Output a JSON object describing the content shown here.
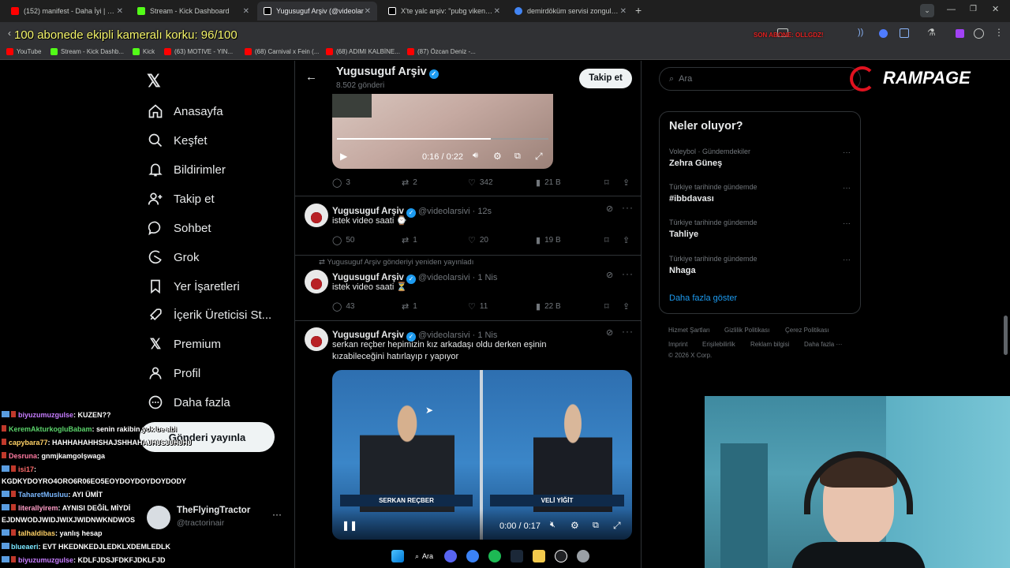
{
  "browser": {
    "tabs": [
      {
        "label": "(152) manifest - Daha İyi | Offic",
        "color": "#ff0000",
        "active": false
      },
      {
        "label": "Stream - Kick Dashboard",
        "color": "#53fc18",
        "active": false
      },
      {
        "label": "Yugusuguf Arşiv (@videolar",
        "color": "#ffffff",
        "active": true
      },
      {
        "label": "X'te yalc arşiv: \"pubg vikendi h",
        "color": "#ffffff",
        "active": false
      },
      {
        "label": "demirdöküm servisi zonguldak",
        "color": "#4285f4",
        "active": false
      }
    ],
    "new_tab": "+",
    "overlay_title": "100 abonede ekipli kameralı korku: 96/100",
    "overlay_sub": "SON ABONE: OLLGDZ!",
    "bookmarks": [
      {
        "label": "YouTube",
        "color": "#ff0000"
      },
      {
        "label": "Stream - Kick Dashb...",
        "color": "#53fc18"
      },
      {
        "label": "Kick",
        "color": "#53fc18"
      },
      {
        "label": "(63) MOTIVE - YIN...",
        "color": "#ff0000"
      },
      {
        "label": "(68) Carnival x Fein (...",
        "color": "#ff0000"
      },
      {
        "label": "(68) ADIMI KALBİNE...",
        "color": "#ff0000"
      },
      {
        "label": "(87) Özcan Deniz -...",
        "color": "#ff0000"
      }
    ]
  },
  "sidebar": {
    "items": [
      {
        "label": "Anasayfa",
        "icon": "home-icon"
      },
      {
        "label": "Keşfet",
        "icon": "search-icon"
      },
      {
        "label": "Bildirimler",
        "icon": "bell-icon"
      },
      {
        "label": "Takip et",
        "icon": "follow-icon"
      },
      {
        "label": "Sohbet",
        "icon": "chat-icon"
      },
      {
        "label": "Grok",
        "icon": "grok-icon"
      },
      {
        "label": "Yer İşaretleri",
        "icon": "bookmark-icon"
      },
      {
        "label": "İçerik Üreticisi St...",
        "icon": "rocket-icon"
      },
      {
        "label": "Premium",
        "icon": "x-icon"
      },
      {
        "label": "Profil",
        "icon": "person-icon"
      },
      {
        "label": "Daha fazla",
        "icon": "more-icon"
      }
    ],
    "post_button": "Gönderi yayınla",
    "account_name": "TheFlyingTractor",
    "account_handle": "@tractorinair"
  },
  "profile_header": {
    "name": "Yugusuguf Arşiv",
    "post_count": "8.502 gönderi",
    "follow_button": "Takip et"
  },
  "feed": {
    "video1": {
      "time": "0:16 / 0:22",
      "replies": "3",
      "reposts": "2",
      "likes": "342",
      "views": "21 B"
    },
    "posts": [
      {
        "name": "Yugusuguf Arşiv",
        "handle": "@videolarsivi",
        "time": "12s",
        "text": "istek video saati ⌚",
        "replies": "50",
        "reposts": "1",
        "likes": "20",
        "views": "19 B"
      },
      {
        "repost_note": "Yugusuguf Arşiv gönderiyi yeniden yayınladı",
        "name": "Yugusuguf Arşiv",
        "handle": "@videolarsivi",
        "time": "1 Nis",
        "text": "istek video saati ⏳",
        "replies": "43",
        "reposts": "1",
        "likes": "11",
        "views": "22 B"
      },
      {
        "name": "Yugusuguf Arşiv",
        "handle": "@videolarsivi",
        "time": "1 Nis",
        "text": "serkan reçber hepimizin kız arkadaşı oldu derken eşinin kızabileceğini hatırlayıp r yapıyor"
      }
    ],
    "video2": {
      "time": "0:00 / 0:17",
      "left_caption": "SERKAN REÇBER",
      "right_caption": "VELİ YİĞİT"
    }
  },
  "right": {
    "search_placeholder": "Ara",
    "trends_title": "Neler oluyor?",
    "trends": [
      {
        "context": "Voleybol · Gündemdekiler",
        "name": "Zehra Güneş"
      },
      {
        "context": "Türkiye tarihinde gündemde",
        "name": "#ibbdavası"
      },
      {
        "context": "Türkiye tarihinde gündemde",
        "name": "Tahliye"
      },
      {
        "context": "Türkiye tarihinde gündemde",
        "name": "Nhaga"
      }
    ],
    "show_more": "Daha fazla göster",
    "footer": [
      "Hizmet Şartları",
      "Gizlilik Politikası",
      "Çerez Politikası",
      "Imprint",
      "Erişilebilirlik",
      "Reklam bilgisi",
      "Daha fazla ···",
      "© 2026 X Corp."
    ]
  },
  "stream_logo": "RAMPAGE",
  "chat": [
    {
      "user": "biyuzumuzgulse",
      "color": "#c77dff",
      "msg": ": KUZEN??"
    },
    {
      "user": "KeremAkturkogluBabam",
      "color": "#5bd36b",
      "msg": ": senin rakibin yok be abi"
    },
    {
      "user": "capybara77",
      "color": "#ffd166",
      "msg": ": HAHHAHAHHSHAJSHHAHAJHJSJJHJHJ"
    },
    {
      "user": "Desruna",
      "color": "#ff7aa2",
      "msg": ": gnmjkamgolşwaga"
    },
    {
      "user": "isi17",
      "color": "#ff6b6b",
      "msg": ":"
    },
    {
      "user": "",
      "color": "#ffffff",
      "msg": "KGDKYDOYRO4ORO6R06EO5EOYDOYDOYDOYDODY"
    },
    {
      "user": "TaharetMusluu",
      "color": "#7ab8ff",
      "msg": ": AYI ÜMİT"
    },
    {
      "user": "literallyirem",
      "color": "#ff9ec7",
      "msg": ": AYNISI DEĞİL MİYDİ"
    },
    {
      "user": "",
      "color": "#ffffff",
      "msg": "EJDNWODJWIDJWIXJWIDNWKNDWOS"
    },
    {
      "user": "talhaldibas",
      "color": "#ffd166",
      "msg": ": yanlış hesap"
    },
    {
      "user": "blueaeri",
      "color": "#7ae7ff",
      "msg": ": EVT HKEDNKEDJLEDKLXDEMLEDLK"
    },
    {
      "user": "biyuzumuzgulse",
      "color": "#c77dff",
      "msg": ": KDLFJDSJFDKFJDKLFJD"
    }
  ],
  "taskbar": {
    "search": "Ara"
  }
}
